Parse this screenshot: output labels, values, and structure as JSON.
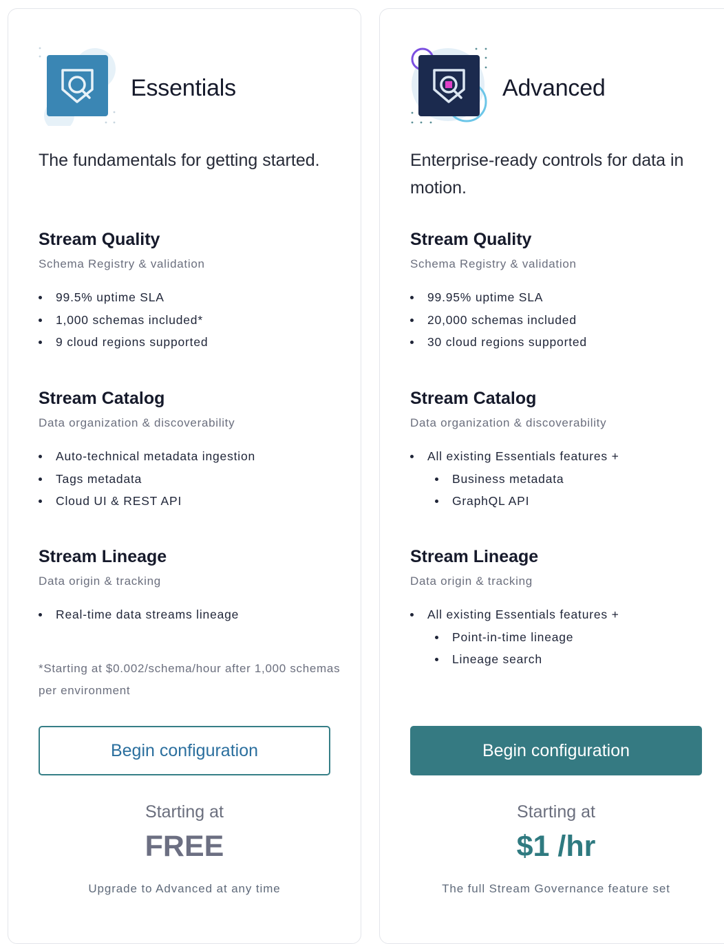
{
  "essentials": {
    "title": "Essentials",
    "description": "The fundamentals for getting started.",
    "sections": [
      {
        "title": "Stream Quality",
        "subtitle": "Schema Registry & validation",
        "items": [
          "99.5% uptime SLA",
          "1,000 schemas included*",
          "9 cloud regions supported"
        ]
      },
      {
        "title": "Stream Catalog",
        "subtitle": "Data organization & discoverability",
        "items": [
          "Auto-technical metadata ingestion",
          "Tags metadata",
          "Cloud UI & REST API"
        ]
      },
      {
        "title": "Stream Lineage",
        "subtitle": "Data origin & tracking",
        "items": [
          "Real-time data streams lineage"
        ]
      }
    ],
    "footnote": "*Starting at $0.002/schema/hour after 1,000 schemas per environment",
    "button_label": "Begin configuration",
    "starting_label": "Starting at",
    "price": "FREE",
    "price_note": "Upgrade to Advanced at any time"
  },
  "advanced": {
    "title": "Advanced",
    "description": "Enterprise-ready controls for data in motion.",
    "sections": [
      {
        "title": "Stream Quality",
        "subtitle": "Schema Registry & validation",
        "items": [
          "99.95% uptime SLA",
          "20,000 schemas included",
          "30 cloud regions supported"
        ]
      },
      {
        "title": "Stream Catalog",
        "subtitle": "Data organization & discoverability",
        "items": [
          "All existing Essentials features +",
          "Business metadata",
          "GraphQL API"
        ]
      },
      {
        "title": "Stream Lineage",
        "subtitle": "Data origin & tracking",
        "items": [
          "All existing Essentials features +",
          "Point-in-time lineage",
          "Lineage search"
        ]
      }
    ],
    "button_label": "Begin configuration",
    "starting_label": "Starting at",
    "price": "$1 /hr",
    "price_note": "The full Stream Governance feature set"
  },
  "colors": {
    "teal": "#357a82",
    "link_blue": "#2b6f9e",
    "essentials_logo": "#3a86b4",
    "advanced_logo": "#1b2a4e",
    "accent_magenta": "#e040c8"
  },
  "icons": {
    "essentials_logo": "shield-search-icon",
    "advanced_logo": "shield-search-icon"
  }
}
